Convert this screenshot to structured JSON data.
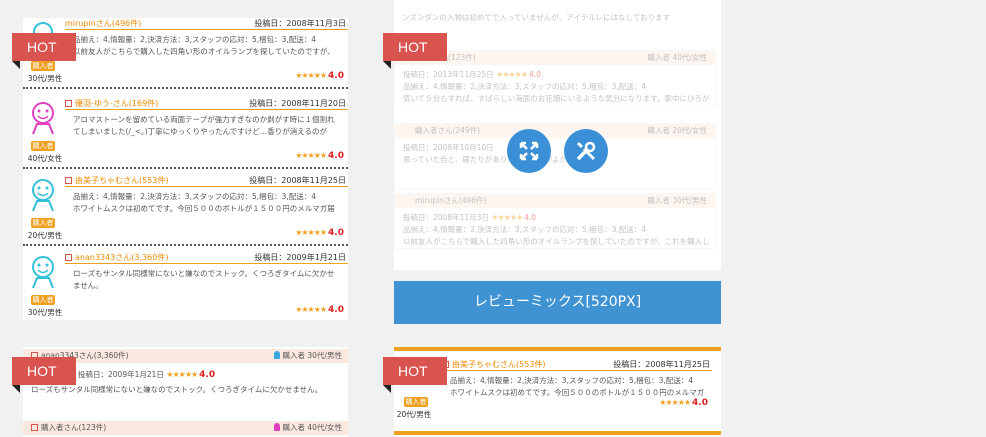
{
  "hot_label": "HOT",
  "left_reviews": [
    {
      "name": "mirupinさん(496件)",
      "date": "投稿日：2008年11月3日",
      "body1": "品揃え：4,情報量：2,決済方法：3,スタッフの応対：5,梱包：3,配送：4",
      "body2": "以前友人がこちらで購入した四角い形のオイルランプを探していたのですが、",
      "badge": "購入者",
      "age": "30代/男性",
      "rating": "4.0"
    },
    {
      "name": "優羽-ゆう-さん(169件)",
      "date": "投稿日：2008年11月20日",
      "body1": "アロマストーンを留めている両面テープが強力すぎなのか剥がす時に１個割れ",
      "body2": "てしまいました(/_<。)丁寧にゆっくりやったんですけど…香りが消えるのが",
      "badge": "購入者",
      "age": "40代/女性",
      "rating": "4.0"
    },
    {
      "name": "由美子ちゃむさん(553件)",
      "date": "投稿日：2008年11月25日",
      "body1": "品揃え：4,情報量：2,決済方法：3,スタッフの応対：5,梱包：3,配送：4",
      "body2": "ホワイトムスクは初めてです。今回５００のボトルが１５００円のメルマガ届",
      "badge": "購入者",
      "age": "20代/男性",
      "rating": "4.0"
    },
    {
      "name": "anan3343さん(3,360件)",
      "date": "投稿日：2009年1月21日",
      "body1": "ローズもサンタル同様常にないと嫌なのでストック。くつろぎタイムに欠かせ",
      "body2": "ません。",
      "badge": "購入者",
      "age": "30代/男性",
      "rating": "4.0"
    }
  ],
  "faded": {
    "top_text": "ンズンダンの入物は初めてで入っていまぜんが、アイテルレにはなしております",
    "blocks": [
      {
        "name": "nekoさん(123件)",
        "buyer": "購入者 40代/女性",
        "date": "投稿日：2013年11月25日",
        "rating": "4.0",
        "body1": "品揃え：4,情報量：2,決済方法：3,スタッフの応対：5,梱包：3,配送：4",
        "body2": "気いて５分もすれば、すばらしい海面のお花畑にいるような気分になります。家中にひろが"
      },
      {
        "name": "購入者さん(249件)",
        "buyer": "購入者 20代/女性",
        "date": "投稿日：2008年10月10日",
        "rating": "4.0",
        "body1": "",
        "body2": "思っていた色と、届たりがあり…少し…色がよかったかな。"
      },
      {
        "name": "mirupinさん(496件)",
        "buyer": "購入者 30代/男性",
        "date": "投稿日：2008年11月3日",
        "rating": "4.0",
        "body1": "品揃え：4,情報量：2,決済方法：3,スタッフの応対：5,梱包：3,配送：4",
        "body2": "以前友人がこちらで購入した四角い形のオイルランプを探していたのですが、これを購入し"
      }
    ]
  },
  "review_mix_button": "レビューミックス[520PX]",
  "bottom_left": {
    "head1_name": "anan3343さん(3,360件)",
    "head1_buyer": "購入者 30代/男性",
    "date": "投稿日：2009年1月21日",
    "rating": "4.0",
    "body": "ローズもサンタル同様常にないと嫌なのでストック。くつろぎタイムに欠かせません。",
    "head2_name": "購入者さん(123件)",
    "head2_buyer": "購入者 40代/女性"
  },
  "bottom_right": {
    "name": "由美子ちゃむさん(553件)",
    "date": "投稿日：2008年11月25日",
    "body1": "品揃え：4,情報量：2,決済方法：3,スタッフの応対：5,梱包：3,配送：4",
    "body2": "ホワイトムスクは初めてです。今回５００のボトルが１５００円のメルマガ",
    "badge": "購入者",
    "age": "20代/男性",
    "rating": "4.0"
  },
  "stars_glyph": "★★★★★"
}
